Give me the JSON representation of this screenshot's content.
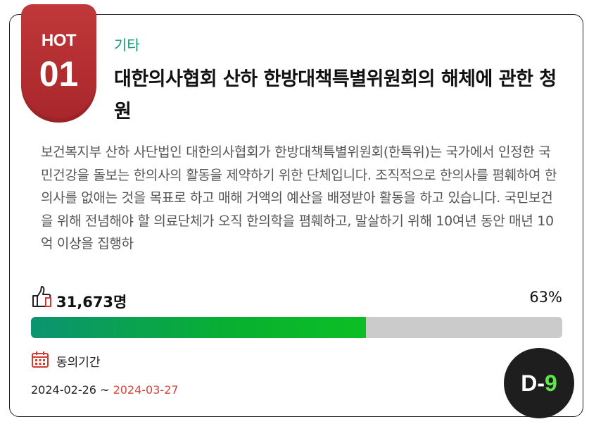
{
  "badge": {
    "hot_label": "HOT",
    "rank": "01",
    "color": "#b02e30"
  },
  "petition": {
    "category": "기타",
    "title": "대한의사협회 산하 한방대책특별위원회의 해체에 관한 청원",
    "summary": "보건복지부 산하 사단법인 대한의사협회가 한방대책특별위원회(한특위)는 국가에서 인정한 국민건강을 돌보는 한의사의 활동을 제약하기 위한 단체입니다. 조직적으로 한의사를 폄훼하여 한의사를 없애는 것을 목표로 하고 매해 거액의 예산을 배정받아 활동을 하고 있습니다. 국민보건을 위해 전념해야 할 의료단체가 오직 한의학을 폄훼하고, 말살하기 위해 10여년 동안 매년 10억 이상을 집행하"
  },
  "support": {
    "icon": "thumbs-up-icon",
    "count": "31,673명",
    "percent_label": "63%",
    "progress_fraction": 0.63,
    "accent_color": "#08b030"
  },
  "period": {
    "icon": "calendar-icon",
    "label": "동의기간",
    "start": "2024-02-26",
    "separator": " ~ ",
    "end": "2024-03-27"
  },
  "dday": {
    "prefix": "D-",
    "number": "9"
  }
}
